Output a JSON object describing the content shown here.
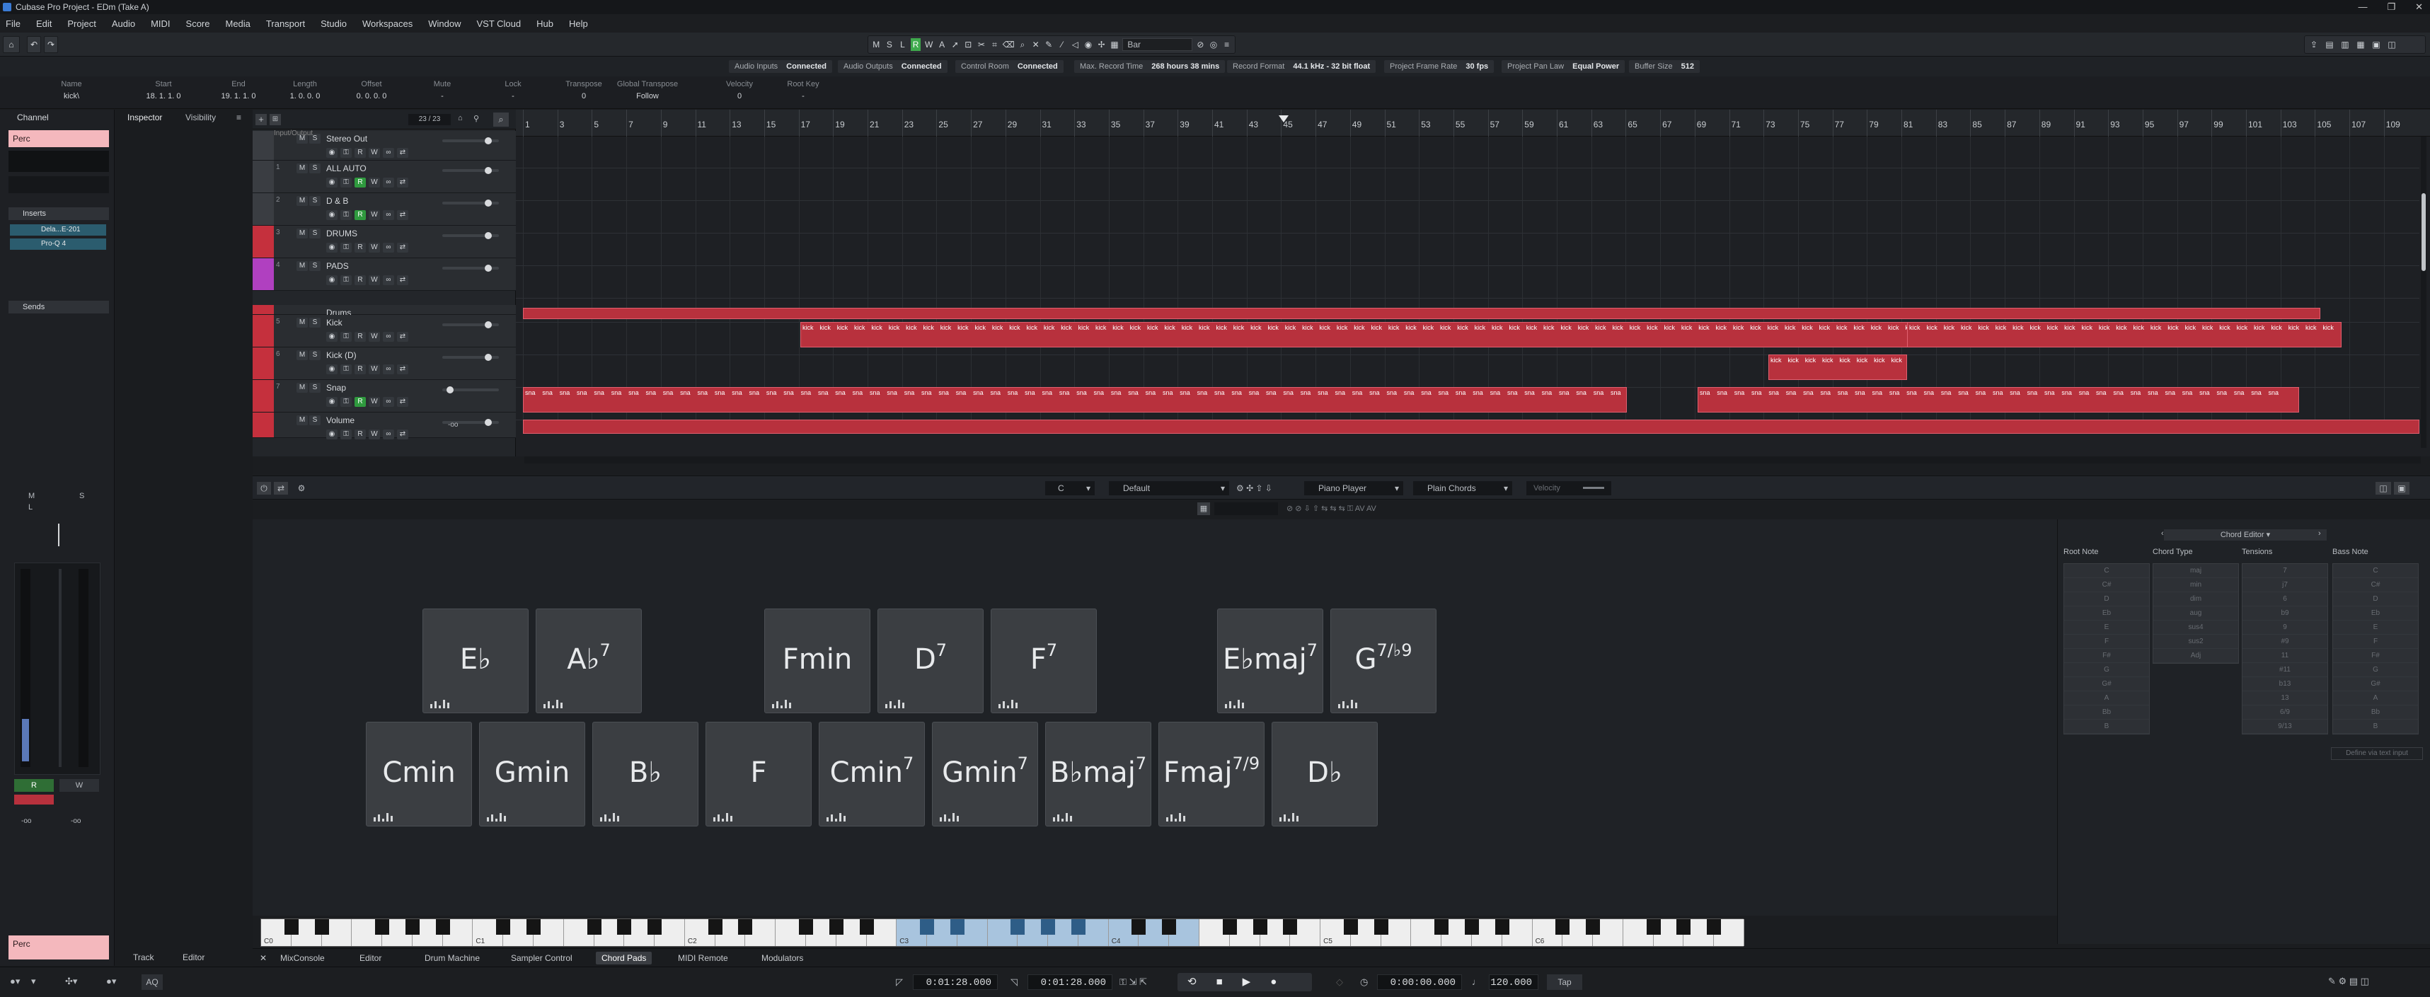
{
  "window": {
    "title": "Cubase Pro Project - EDm (Take A)",
    "controls": [
      "—",
      "❐",
      "✕"
    ]
  },
  "menu": [
    "File",
    "Edit",
    "Project",
    "Audio",
    "MIDI",
    "Score",
    "Media",
    "Transport",
    "Studio",
    "Workspaces",
    "Window",
    "VST Cloud",
    "Hub",
    "Help"
  ],
  "toolbar": {
    "mode_buttons": [
      "M",
      "S",
      "L",
      "R",
      "W",
      "A"
    ],
    "snap_label": "Bar",
    "icons": [
      "home-icon",
      "undo-icon",
      "redo-icon"
    ]
  },
  "status": {
    "items": [
      {
        "label": "Audio Inputs",
        "value": "Connected"
      },
      {
        "label": "Audio Outputs",
        "value": "Connected"
      },
      {
        "label": "Control Room",
        "value": "Connected"
      },
      {
        "label": "Max. Record Time",
        "value": "268 hours 38 mins"
      },
      {
        "label": "Record Format",
        "value": "44.1 kHz - 32 bit float"
      },
      {
        "label": "Project Frame Rate",
        "value": "30 fps"
      },
      {
        "label": "Project Pan Law",
        "value": "Equal Power"
      },
      {
        "label": "Buffer Size",
        "value": "512"
      }
    ]
  },
  "infoline": {
    "fields": [
      {
        "label": "Name",
        "value": "kick\\"
      },
      {
        "label": "Start",
        "value": "18. 1. 1.   0"
      },
      {
        "label": "End",
        "value": "19. 1. 1.   0"
      },
      {
        "label": "Length",
        "value": "1. 0. 0.   0"
      },
      {
        "label": "Offset",
        "value": "0. 0. 0.   0"
      },
      {
        "label": "Mute",
        "value": "-"
      },
      {
        "label": "Lock",
        "value": "-"
      },
      {
        "label": "Transpose",
        "value": "0"
      },
      {
        "label": "Global Transpose",
        "value": "Follow"
      },
      {
        "label": "Velocity",
        "value": "0"
      },
      {
        "label": "Root Key",
        "value": "-"
      }
    ]
  },
  "left": {
    "tab": "Channel",
    "track_name": "Perc",
    "inserts_label": "Inserts",
    "inserts": [
      "Dela...E-201",
      "Pro-Q 4"
    ],
    "sends_label": "Sends",
    "meter_vals": [
      "-oo",
      "-oo"
    ],
    "bottom_name": "Perc",
    "ms_labels": [
      "M",
      "S",
      "L"
    ],
    "rw_labels": [
      "R",
      "W"
    ]
  },
  "inspector": {
    "tabs": [
      "Inspector",
      "Visibility"
    ]
  },
  "tracklist": {
    "count": "23 / 23",
    "header": "Input/Output",
    "tracks": [
      {
        "num": "",
        "name": "Stereo Out",
        "color": "#3a3d42"
      },
      {
        "num": "1",
        "name": "ALL AUTO",
        "color": "#3a3d42"
      },
      {
        "num": "2",
        "name": "D & B",
        "color": "#3a3d42"
      },
      {
        "num": "3",
        "name": "DRUMS",
        "color": "#c5303d"
      },
      {
        "num": "4",
        "name": "PADS",
        "color": "#b040c0"
      },
      {
        "num": "",
        "name": "Drums",
        "color": "#c5303d"
      },
      {
        "num": "5",
        "name": "Kick",
        "color": "#c5303d"
      },
      {
        "num": "6",
        "name": "Kick (D)",
        "color": "#c5303d"
      },
      {
        "num": "7",
        "name": "Snap",
        "color": "#c5303d"
      },
      {
        "num": "",
        "name": "Volume",
        "color": "#c5303d"
      }
    ],
    "auto_value": "-oo"
  },
  "ruler": {
    "bars": [
      "1",
      "3",
      "5",
      "7",
      "9",
      "11",
      "13",
      "15",
      "17",
      "19",
      "21",
      "23",
      "25",
      "27",
      "29",
      "31",
      "33",
      "35",
      "37",
      "39",
      "41",
      "43",
      "45",
      "47",
      "49",
      "51",
      "53",
      "55",
      "57",
      "59",
      "61",
      "63",
      "65",
      "67",
      "69",
      "71",
      "73",
      "75",
      "77",
      "79",
      "81",
      "83",
      "85",
      "87",
      "89",
      "91",
      "93",
      "95",
      "97",
      "99",
      "101",
      "103",
      "105",
      "107",
      "109"
    ]
  },
  "parts": {
    "kick_label": "kick",
    "snap_label": "sna"
  },
  "lower_toolbar": {
    "key": "C",
    "preset": "Default",
    "player": "Piano Player",
    "chords": "Plain Chords",
    "velocity": "Velocity"
  },
  "pads": {
    "row1": [
      {
        "root": "E♭",
        "sup": ""
      },
      {
        "root": "A♭",
        "sup": "7"
      },
      {
        "root": "Fmin",
        "sup": ""
      },
      {
        "root": "D",
        "sup": "7"
      },
      {
        "root": "F",
        "sup": "7"
      },
      {
        "root": "E♭maj",
        "sup": "7"
      },
      {
        "root": "G",
        "sup": "7/♭9"
      }
    ],
    "row2": [
      {
        "root": "Cmin",
        "sup": ""
      },
      {
        "root": "Gmin",
        "sup": ""
      },
      {
        "root": "B♭",
        "sup": ""
      },
      {
        "root": "F",
        "sup": ""
      },
      {
        "root": "Cmin",
        "sup": "7"
      },
      {
        "root": "Gmin",
        "sup": "7"
      },
      {
        "root": "B♭maj",
        "sup": "7"
      },
      {
        "root": "Fmaj",
        "sup": "7/9"
      },
      {
        "root": "D♭",
        "sup": ""
      }
    ]
  },
  "chord_editor": {
    "title": "Chord Editor",
    "columns": [
      "Root Note",
      "Chord Type",
      "Tensions",
      "Bass Note"
    ],
    "root_notes": [
      "C",
      "C#",
      "D",
      "Eb",
      "E",
      "F",
      "F#",
      "G",
      "G#",
      "A",
      "Bb",
      "B"
    ],
    "chord_types": [
      "maj",
      "min",
      "dim",
      "aug",
      "sus4",
      "sus2",
      "Adj"
    ],
    "tensions": [
      "7",
      "j7",
      "6",
      "b9",
      "9",
      "#9",
      "11",
      "#11",
      "b13",
      "13",
      "6/9",
      "9/13"
    ],
    "bass_notes": [
      "C",
      "C#",
      "D",
      "Eb",
      "E",
      "F",
      "F#",
      "G",
      "G#",
      "A",
      "Bb",
      "B"
    ],
    "text_input": "Define via text input"
  },
  "keyboard": {
    "labels": [
      "C0",
      "C1",
      "C2",
      "C3",
      "C4",
      "C5",
      "C6"
    ]
  },
  "bottom_tabs": [
    "Track",
    "Editor",
    "MixConsole",
    "Editor",
    "Drum Machine",
    "Sampler Control",
    "Chord Pads",
    "MIDI Remote",
    "Modulators"
  ],
  "transport": {
    "left_locator": "0:01:28.000",
    "right_locator": "0:01:28.000",
    "position": "0:00:00.000",
    "tempo": "120.000",
    "tap": "Tap",
    "aq": "AQ"
  }
}
